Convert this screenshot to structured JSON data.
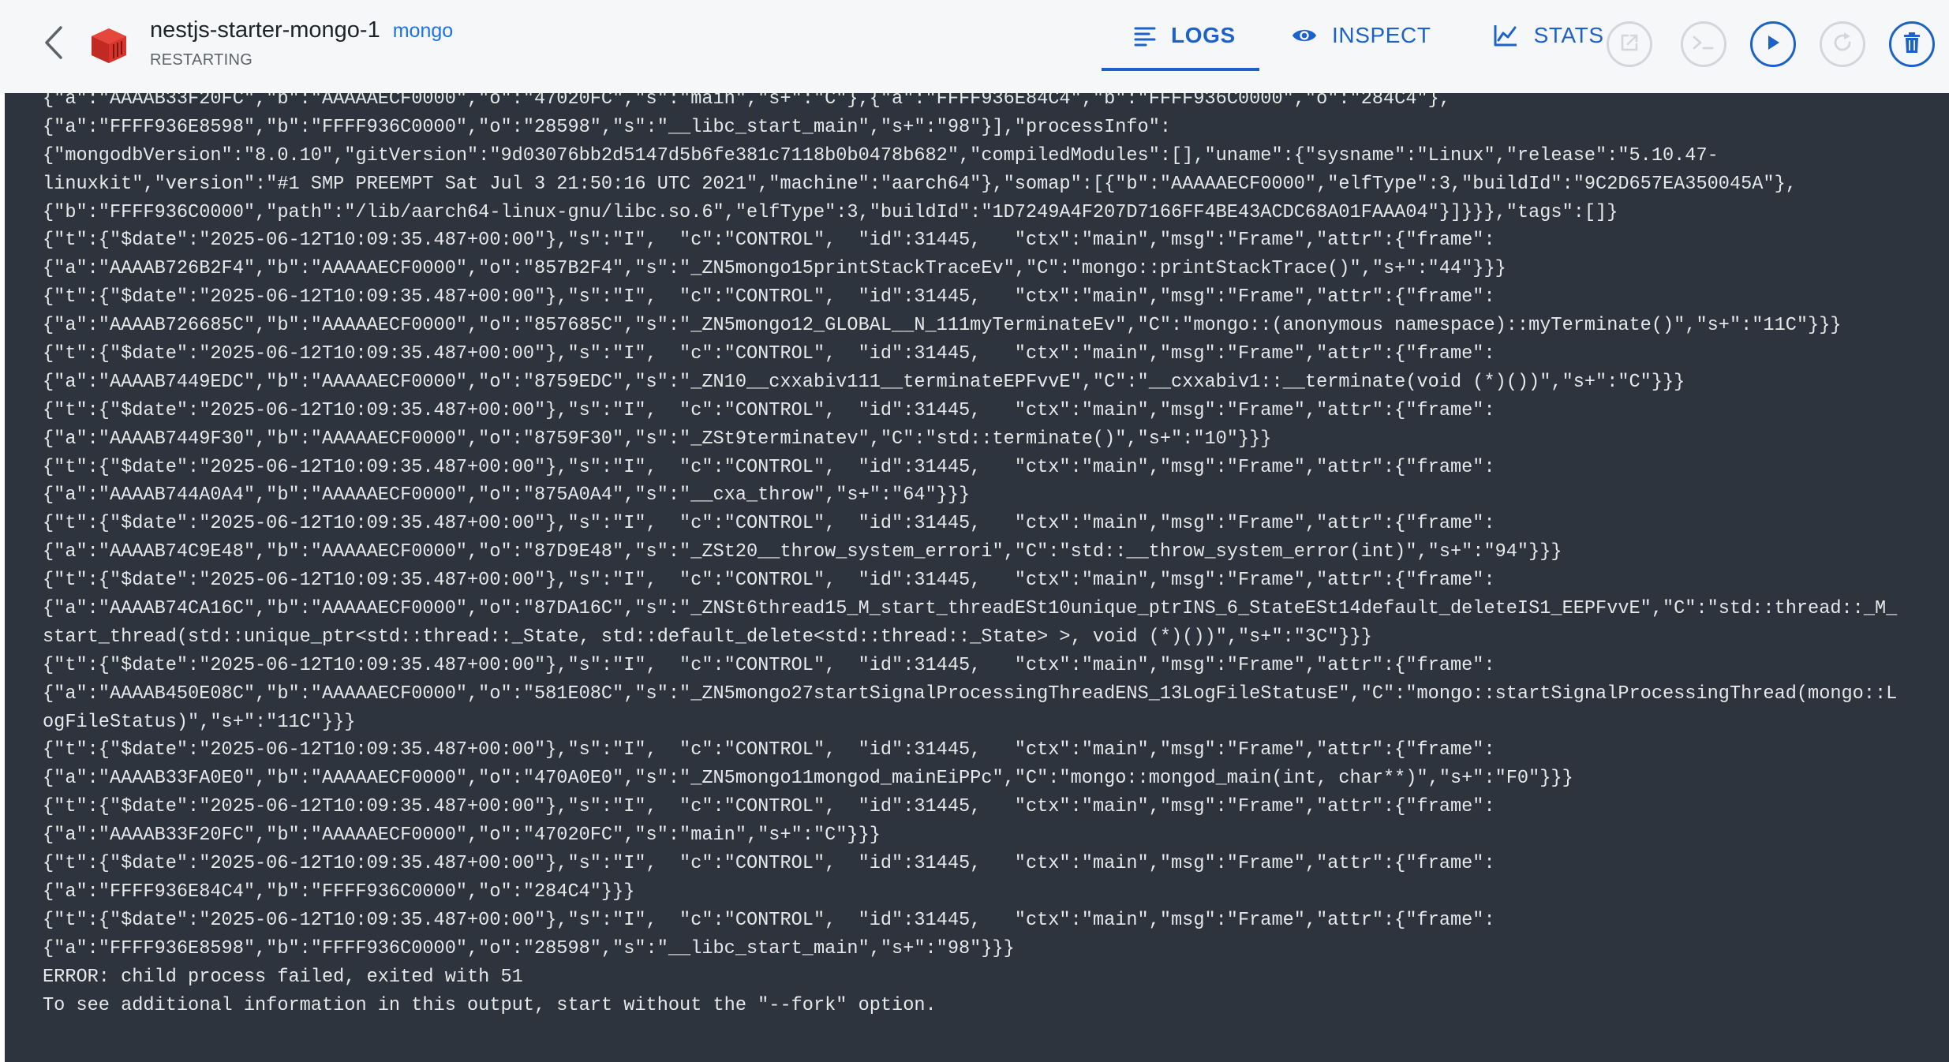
{
  "header": {
    "container_name": "nestjs-starter-mongo-1",
    "image_name": "mongo",
    "status": "RESTARTING",
    "tabs": [
      {
        "label": "LOGS",
        "icon": "logs-icon",
        "active": true
      },
      {
        "label": "INSPECT",
        "icon": "eye-icon",
        "active": false
      },
      {
        "label": "STATS",
        "icon": "chart-icon",
        "active": false
      }
    ],
    "actions": [
      {
        "name": "open-in-browser",
        "icon": "open-external-icon",
        "enabled": false
      },
      {
        "name": "cli",
        "icon": "terminal-icon",
        "enabled": false
      },
      {
        "name": "start",
        "icon": "play-icon",
        "enabled": true
      },
      {
        "name": "restart",
        "icon": "restart-icon",
        "enabled": false
      },
      {
        "name": "delete",
        "icon": "trash-icon",
        "enabled": true
      }
    ],
    "colors": {
      "accent": "#1d62c8",
      "header_bg": "#f6f7f8",
      "log_bg": "#2d343d",
      "log_text": "#e6e8ea",
      "container_icon": "#d9342b"
    }
  },
  "logs": [
    "{\"a\":\"AAAAB33F20FC\",\"b\":\"AAAAAECF0000\",\"o\":\"47020FC\",\"s\":\"main\",\"s+\":\"C\"},{\"a\":\"FFFF936E84C4\",\"b\":\"FFFF936C0000\",\"o\":\"284C4\"},",
    "{\"a\":\"FFFF936E8598\",\"b\":\"FFFF936C0000\",\"o\":\"28598\",\"s\":\"__libc_start_main\",\"s+\":\"98\"}],\"processInfo\":",
    "{\"mongodbVersion\":\"8.0.10\",\"gitVersion\":\"9d03076bb2d5147d5b6fe381c7118b0b0478b682\",\"compiledModules\":[],\"uname\":{\"sysname\":\"Linux\",\"release\":\"5.10.47-",
    "linuxkit\",\"version\":\"#1 SMP PREEMPT Sat Jul 3 21:50:16 UTC 2021\",\"machine\":\"aarch64\"},\"somap\":[{\"b\":\"AAAAAECF0000\",\"elfType\":3,\"buildId\":\"9C2D657EA350045A\"},",
    "{\"b\":\"FFFF936C0000\",\"path\":\"/lib/aarch64-linux-gnu/libc.so.6\",\"elfType\":3,\"buildId\":\"1D7249A4F207D7166FF4BE43ACDC68A01FAAA04\"}]}}},\"tags\":[]}",
    "{\"t\":{\"$date\":\"2025-06-12T10:09:35.487+00:00\"},\"s\":\"I\",  \"c\":\"CONTROL\",  \"id\":31445,   \"ctx\":\"main\",\"msg\":\"Frame\",\"attr\":{\"frame\":",
    "{\"a\":\"AAAAB726B2F4\",\"b\":\"AAAAAECF0000\",\"o\":\"857B2F4\",\"s\":\"_ZN5mongo15printStackTraceEv\",\"C\":\"mongo::printStackTrace()\",\"s+\":\"44\"}}}",
    "{\"t\":{\"$date\":\"2025-06-12T10:09:35.487+00:00\"},\"s\":\"I\",  \"c\":\"CONTROL\",  \"id\":31445,   \"ctx\":\"main\",\"msg\":\"Frame\",\"attr\":{\"frame\":",
    "{\"a\":\"AAAAB726685C\",\"b\":\"AAAAAECF0000\",\"o\":\"857685C\",\"s\":\"_ZN5mongo12_GLOBAL__N_111myTerminateEv\",\"C\":\"mongo::(anonymous namespace)::myTerminate()\",\"s+\":\"11C\"}}}",
    "{\"t\":{\"$date\":\"2025-06-12T10:09:35.487+00:00\"},\"s\":\"I\",  \"c\":\"CONTROL\",  \"id\":31445,   \"ctx\":\"main\",\"msg\":\"Frame\",\"attr\":{\"frame\":",
    "{\"a\":\"AAAAB7449EDC\",\"b\":\"AAAAAECF0000\",\"o\":\"8759EDC\",\"s\":\"_ZN10__cxxabiv111__terminateEPFvvE\",\"C\":\"__cxxabiv1::__terminate(void (*)())\",\"s+\":\"C\"}}}",
    "{\"t\":{\"$date\":\"2025-06-12T10:09:35.487+00:00\"},\"s\":\"I\",  \"c\":\"CONTROL\",  \"id\":31445,   \"ctx\":\"main\",\"msg\":\"Frame\",\"attr\":{\"frame\":",
    "{\"a\":\"AAAAB7449F30\",\"b\":\"AAAAAECF0000\",\"o\":\"8759F30\",\"s\":\"_ZSt9terminatev\",\"C\":\"std::terminate()\",\"s+\":\"10\"}}}",
    "{\"t\":{\"$date\":\"2025-06-12T10:09:35.487+00:00\"},\"s\":\"I\",  \"c\":\"CONTROL\",  \"id\":31445,   \"ctx\":\"main\",\"msg\":\"Frame\",\"attr\":{\"frame\":",
    "{\"a\":\"AAAAB744A0A4\",\"b\":\"AAAAAECF0000\",\"o\":\"875A0A4\",\"s\":\"__cxa_throw\",\"s+\":\"64\"}}}",
    "{\"t\":{\"$date\":\"2025-06-12T10:09:35.487+00:00\"},\"s\":\"I\",  \"c\":\"CONTROL\",  \"id\":31445,   \"ctx\":\"main\",\"msg\":\"Frame\",\"attr\":{\"frame\":",
    "{\"a\":\"AAAAB74C9E48\",\"b\":\"AAAAAECF0000\",\"o\":\"87D9E48\",\"s\":\"_ZSt20__throw_system_errori\",\"C\":\"std::__throw_system_error(int)\",\"s+\":\"94\"}}}",
    "{\"t\":{\"$date\":\"2025-06-12T10:09:35.487+00:00\"},\"s\":\"I\",  \"c\":\"CONTROL\",  \"id\":31445,   \"ctx\":\"main\",\"msg\":\"Frame\",\"attr\":{\"frame\":",
    "{\"a\":\"AAAAB74CA16C\",\"b\":\"AAAAAECF0000\",\"o\":\"87DA16C\",\"s\":\"_ZNSt6thread15_M_start_threadESt10unique_ptrINS_6_StateESt14default_deleteIS1_EEPFvvE\",\"C\":\"std::thread::_M_",
    "start_thread(std::unique_ptr<std::thread::_State, std::default_delete<std::thread::_State> >, void (*)())\",\"s+\":\"3C\"}}}",
    "{\"t\":{\"$date\":\"2025-06-12T10:09:35.487+00:00\"},\"s\":\"I\",  \"c\":\"CONTROL\",  \"id\":31445,   \"ctx\":\"main\",\"msg\":\"Frame\",\"attr\":{\"frame\":",
    "{\"a\":\"AAAAB450E08C\",\"b\":\"AAAAAECF0000\",\"o\":\"581E08C\",\"s\":\"_ZN5mongo27startSignalProcessingThreadENS_13LogFileStatusE\",\"C\":\"mongo::startSignalProcessingThread(mongo::L",
    "ogFileStatus)\",\"s+\":\"11C\"}}}",
    "{\"t\":{\"$date\":\"2025-06-12T10:09:35.487+00:00\"},\"s\":\"I\",  \"c\":\"CONTROL\",  \"id\":31445,   \"ctx\":\"main\",\"msg\":\"Frame\",\"attr\":{\"frame\":",
    "{\"a\":\"AAAAB33FA0E0\",\"b\":\"AAAAAECF0000\",\"o\":\"470A0E0\",\"s\":\"_ZN5mongo11mongod_mainEiPPc\",\"C\":\"mongo::mongod_main(int, char**)\",\"s+\":\"F0\"}}}",
    "{\"t\":{\"$date\":\"2025-06-12T10:09:35.487+00:00\"},\"s\":\"I\",  \"c\":\"CONTROL\",  \"id\":31445,   \"ctx\":\"main\",\"msg\":\"Frame\",\"attr\":{\"frame\":",
    "{\"a\":\"AAAAB33F20FC\",\"b\":\"AAAAAECF0000\",\"o\":\"47020FC\",\"s\":\"main\",\"s+\":\"C\"}}}",
    "{\"t\":{\"$date\":\"2025-06-12T10:09:35.487+00:00\"},\"s\":\"I\",  \"c\":\"CONTROL\",  \"id\":31445,   \"ctx\":\"main\",\"msg\":\"Frame\",\"attr\":{\"frame\":",
    "{\"a\":\"FFFF936E84C4\",\"b\":\"FFFF936C0000\",\"o\":\"284C4\"}}}",
    "{\"t\":{\"$date\":\"2025-06-12T10:09:35.487+00:00\"},\"s\":\"I\",  \"c\":\"CONTROL\",  \"id\":31445,   \"ctx\":\"main\",\"msg\":\"Frame\",\"attr\":{\"frame\":",
    "{\"a\":\"FFFF936E8598\",\"b\":\"FFFF936C0000\",\"o\":\"28598\",\"s\":\"__libc_start_main\",\"s+\":\"98\"}}}",
    "ERROR: child process failed, exited with 51",
    "To see additional information in this output, start without the \"--fork\" option."
  ]
}
